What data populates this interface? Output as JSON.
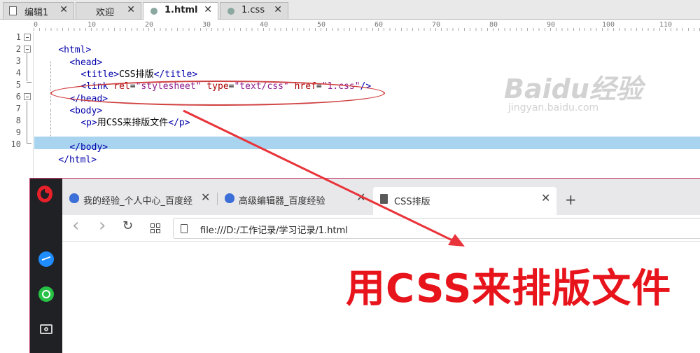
{
  "editor": {
    "tabs": [
      {
        "label": "编辑1",
        "close": "✕",
        "active": false
      },
      {
        "label": "欢迎",
        "close": "✕",
        "active": false
      },
      {
        "label": "1.html",
        "close": "✕",
        "active": true
      },
      {
        "label": "1.css",
        "close": "✕",
        "active": false
      }
    ],
    "ruler": [
      "0",
      "10",
      "20",
      "30",
      "40",
      "50",
      "60",
      "70",
      "80",
      "90",
      "100",
      "110"
    ],
    "line_numbers": [
      "1",
      "2",
      "3",
      "4",
      "5",
      "6",
      "7",
      "8",
      "9",
      "10"
    ],
    "code": {
      "l1": {
        "open": "<html>"
      },
      "l2": {
        "open": "<head>"
      },
      "l3": {
        "open": "<title>",
        "text": "CSS排版",
        "close": "</title>"
      },
      "l4": {
        "open": "<link ",
        "a1": "rel",
        "eq1": "=",
        "v1": "\"stylesheet\"",
        "a2": " type",
        "eq2": "=",
        "v2": "\"text/css\"",
        "a3": " href",
        "eq3": "=",
        "v3": "\"1.css\"",
        "close": "/>"
      },
      "l5": {
        "open": "</head>"
      },
      "l6": {
        "open": "<body>"
      },
      "l7": {
        "open": "<p>",
        "text": "用CSS来排版文件",
        "close": "</p>"
      },
      "l9": {
        "open": "</body>"
      },
      "l10": {
        "open": "</html>"
      }
    }
  },
  "browser": {
    "tabs": [
      {
        "label": "我的经验_个人中心_百度经",
        "close": "✕"
      },
      {
        "label": "高级编辑器_百度经验",
        "close": "✕"
      },
      {
        "label": "CSS排版",
        "close": "✕"
      }
    ],
    "new_tab": "+",
    "nav": {
      "back": "‹",
      "forward": "›",
      "reload": "↻"
    },
    "url": "file:///D:/工作记录/学习记录/1.html",
    "page_text": "用CSS来排版文件"
  },
  "watermark": {
    "logo": "Baidu经验",
    "url": "jingyan.baidu.com"
  },
  "colors": {
    "annotation_red": "#d04040",
    "page_text_red": "#e8141c",
    "selected_line": "#a9d4f0"
  }
}
